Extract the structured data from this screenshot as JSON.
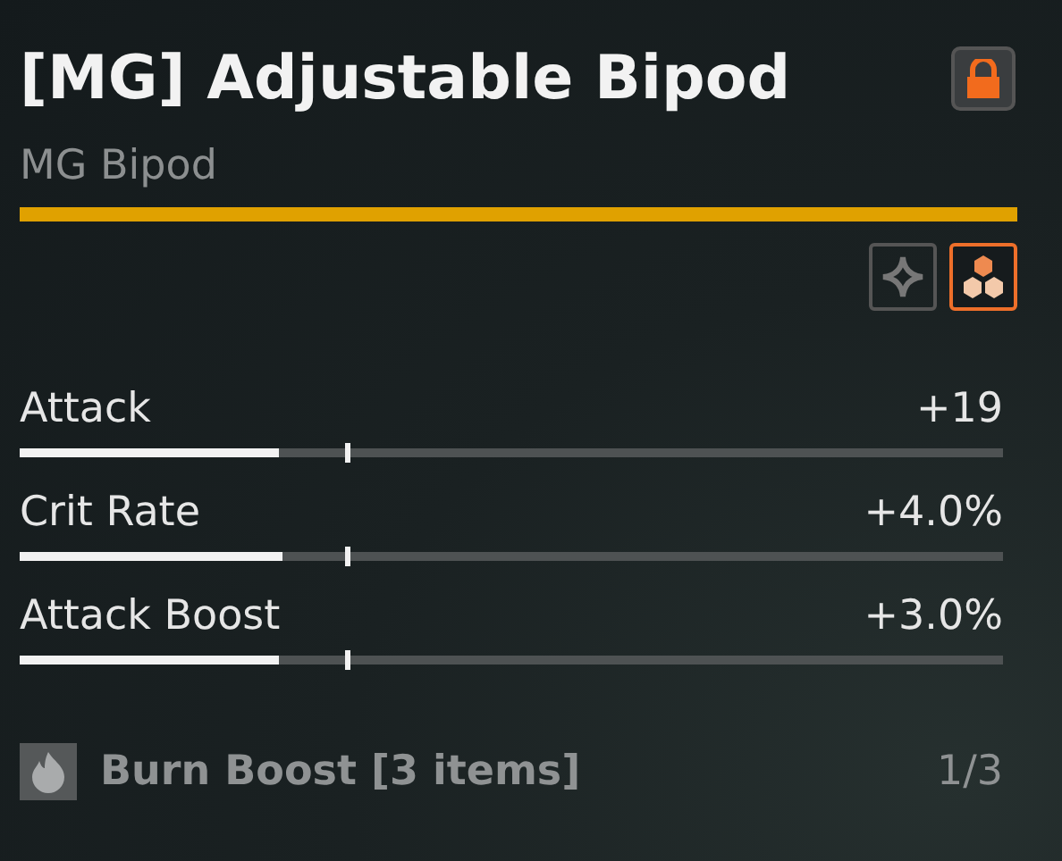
{
  "title": "[MG] Adjustable Bipod",
  "locked": true,
  "subtitle": "MG Bipod",
  "tabs": [
    {
      "kind": "star",
      "selected": false
    },
    {
      "kind": "hex",
      "selected": true
    }
  ],
  "stats": [
    {
      "name": "Attack",
      "value": "+19",
      "level": 0.264,
      "marker": {
        "level": 0.33
      }
    },
    {
      "name": "Crit Rate",
      "value": "+4.0%",
      "level": 0.268,
      "marker": {
        "level": 0.33
      }
    },
    {
      "name": "Attack Boost",
      "value": "+3.0%",
      "level": 0.264,
      "marker": {
        "level": 0.33
      }
    }
  ],
  "set_bonus": {
    "name": "Burn Boost [3 items]",
    "count": "1/3"
  }
}
